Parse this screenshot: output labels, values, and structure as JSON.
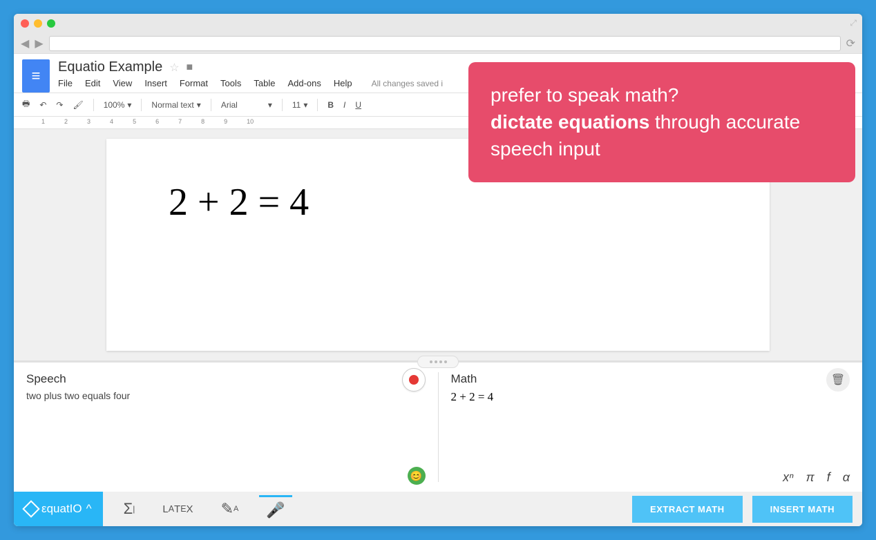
{
  "doc": {
    "title": "Equatio Example",
    "menus": [
      "File",
      "Edit",
      "View",
      "Insert",
      "Format",
      "Tools",
      "Table",
      "Add-ons",
      "Help"
    ],
    "saved_status": "All changes saved i",
    "equation": "2 + 2 = 4"
  },
  "toolbar": {
    "zoom": "100%",
    "style": "Normal text",
    "font": "Arial",
    "size": "11",
    "bold": "B",
    "italic": "I",
    "underline": "U"
  },
  "ruler": [
    "1",
    "2",
    "3",
    "4",
    "5",
    "6",
    "7",
    "8",
    "9",
    "10"
  ],
  "panel": {
    "speech_title": "Speech",
    "speech_text": "two plus two equals four",
    "math_title": "Math",
    "math_preview": "2 + 2 = 4",
    "symbols": [
      "xⁿ",
      "π",
      "f",
      "α"
    ]
  },
  "equatio": {
    "brand": "εquatIO",
    "extract": "EXTRACT MATH",
    "insert": "INSERT MATH"
  },
  "callout": {
    "line1": "prefer to speak math?",
    "strong": "dictate equations",
    "line2_rest": " through accurate speech input"
  }
}
